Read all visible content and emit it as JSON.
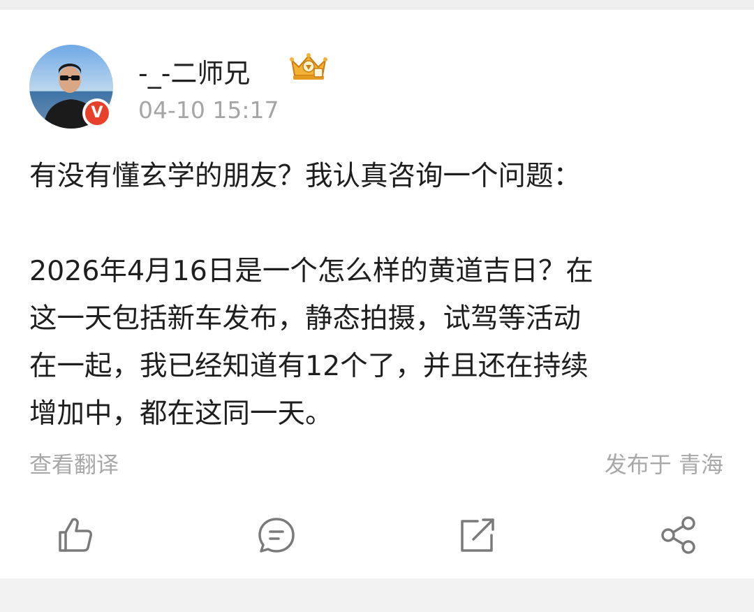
{
  "post": {
    "author": {
      "name": "-_-二师兄",
      "verified_badge": "V",
      "crown_icon": "crown-badge-icon"
    },
    "timestamp": "04-10 15:17",
    "content": {
      "line1": "有没有懂玄学的朋友？我认真咨询一个问题：",
      "line2": "2026年4月16日是一个怎么样的黄道吉日？在",
      "line3": "这一天包括新车发布，静态拍摄，试驾等活动",
      "line4": "在一起，我已经知道有12个了，并且还在持续",
      "line5": "增加中，都在这同一天。"
    },
    "translate_label": "查看翻译",
    "location_label": "发布于 青海"
  },
  "actions": [
    {
      "name": "like",
      "icon": "thumbs-up-icon"
    },
    {
      "name": "comment",
      "icon": "comment-icon"
    },
    {
      "name": "repost",
      "icon": "repost-icon"
    },
    {
      "name": "share",
      "icon": "share-icon"
    }
  ],
  "colors": {
    "verified": "#e8412b",
    "muted_text": "#a8a8a8",
    "body_text": "#1e1e1e",
    "icon_stroke": "#7a7a7a"
  }
}
